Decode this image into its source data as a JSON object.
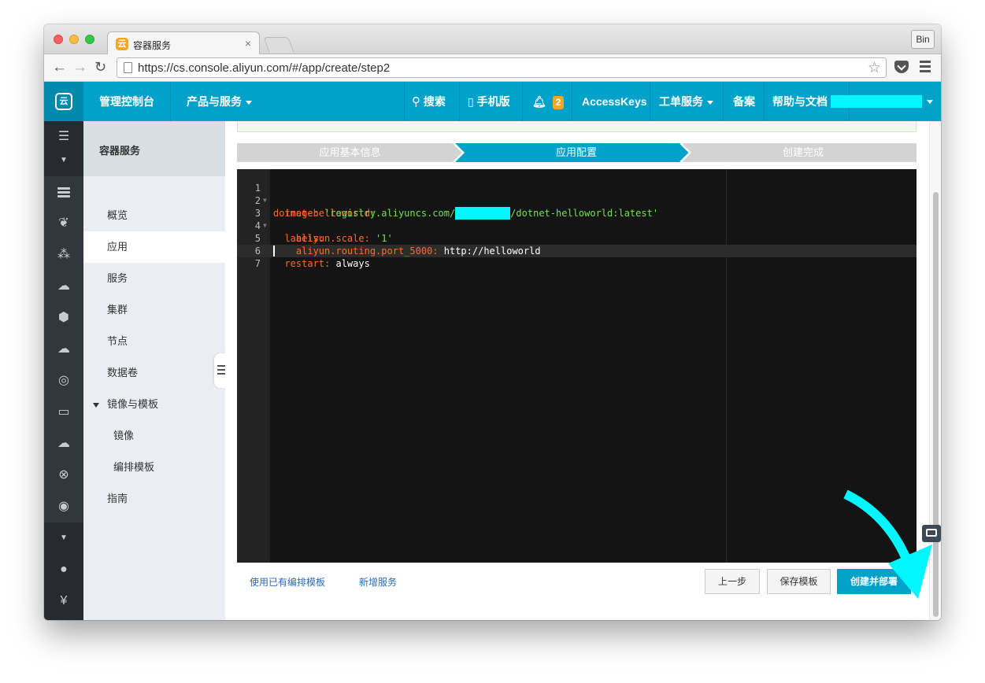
{
  "browser": {
    "tab_title": "容器服务",
    "tab_close": "×",
    "profile": "Bin",
    "url": "https://cs.console.aliyun.com/#/app/create/step2"
  },
  "appbar": {
    "console": "管理控制台",
    "products": "产品与服务",
    "search": "搜索",
    "mobile": "手机版",
    "notifications": "2",
    "accesskeys": "AccessKeys",
    "tickets": "工单服务",
    "beian": "备案",
    "help": "帮助与文档"
  },
  "sidebar": {
    "title": "容器服务",
    "items": [
      {
        "label": "概览"
      },
      {
        "label": "应用"
      },
      {
        "label": "服务"
      },
      {
        "label": "集群"
      },
      {
        "label": "节点"
      },
      {
        "label": "数据卷"
      },
      {
        "label": "镜像与模板"
      },
      {
        "label": "镜像"
      },
      {
        "label": "编排模板"
      },
      {
        "label": "指南"
      }
    ]
  },
  "steps": [
    {
      "label": "应用基本信息",
      "state": "done"
    },
    {
      "label": "应用配置",
      "state": "active"
    },
    {
      "label": "创建完成",
      "state": "pending"
    }
  ],
  "editor": {
    "line_numbers": [
      "1",
      "2",
      "3",
      "4",
      "5",
      "6",
      "7"
    ],
    "lines": {
      "l1_key": "dotnet-helloworld:",
      "l2_key": "  image: ",
      "l2_val_a": "'registry.aliyuncs.com/",
      "l2_val_b": "/dotnet-helloworld:latest'",
      "l3_key": "  labels:",
      "l4_key": "    aliyun.scale: ",
      "l4_val": "'1'",
      "l5_key": "    aliyun.routing.port_5000: ",
      "l5_val": "http://helloworld",
      "l6_key": "  restart: ",
      "l6_val": "always"
    }
  },
  "footer": {
    "use_template": "使用已有编排模板",
    "add_service": "新增服务",
    "prev": "上一步",
    "save_template": "保存模板",
    "create_deploy": "创建并部署"
  },
  "colors": {
    "brand": "#00a2ca",
    "rail": "#32373e",
    "annotation_arrow": "#00f7ff",
    "redaction": "#00f7ff"
  }
}
